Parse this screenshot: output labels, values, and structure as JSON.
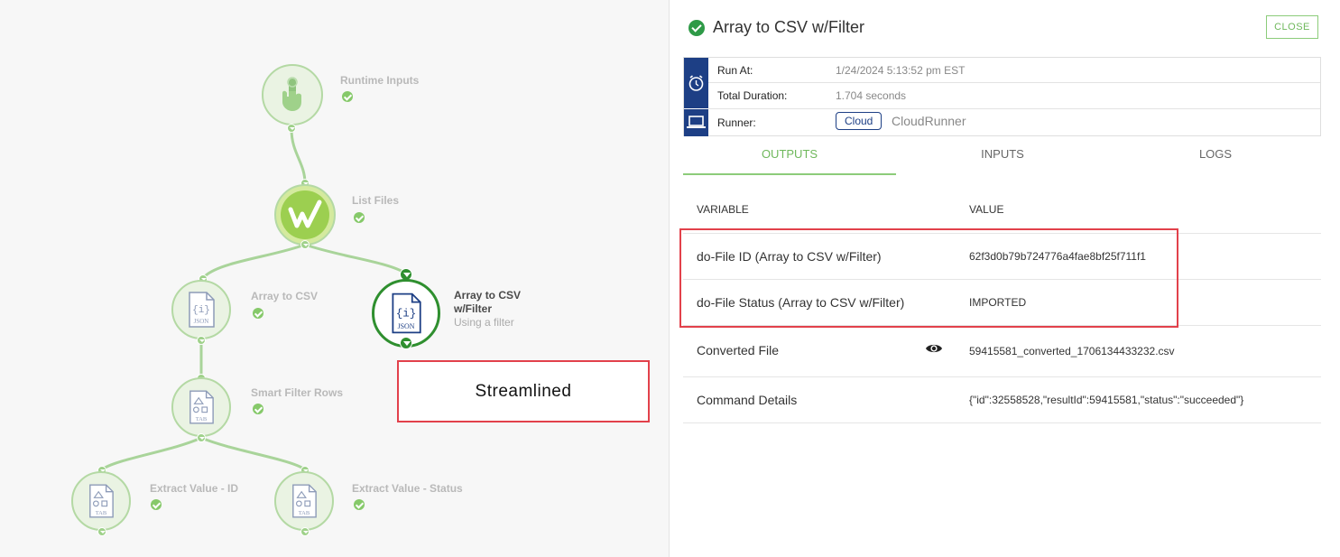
{
  "canvas": {
    "nodes": [
      {
        "id": "runtime-inputs",
        "title": "Runtime Inputs",
        "icon": "hand-pointer-icon"
      },
      {
        "id": "list-files",
        "title": "List Files",
        "icon": "w-logo-icon"
      },
      {
        "id": "array-to-csv",
        "title": "Array to CSV",
        "icon": "json-file-icon",
        "badge": "JSON"
      },
      {
        "id": "array-to-csv-filter",
        "title_line1": "Array to CSV",
        "title_line2": "w/Filter",
        "subtitle": "Using a filter",
        "icon": "json-file-icon",
        "badge": "JSON",
        "active": true
      },
      {
        "id": "smart-filter-rows",
        "title": "Smart Filter Rows",
        "icon": "tab-file-icon",
        "badge": "TAB"
      },
      {
        "id": "extract-value-id",
        "title": "Extract Value - ID",
        "icon": "tab-file-icon",
        "badge": "TAB"
      },
      {
        "id": "extract-value-status",
        "title": "Extract Value - Status",
        "icon": "tab-file-icon",
        "badge": "TAB"
      }
    ],
    "callout": "Streamlined"
  },
  "panel": {
    "title": "Array to CSV w/Filter",
    "close_label": "CLOSE",
    "meta": {
      "run_at_label": "Run At:",
      "run_at_value": "1/24/2024 5:13:52 pm EST",
      "duration_label": "Total Duration:",
      "duration_value": "1.704 seconds",
      "runner_label": "Runner:",
      "runner_tag": "Cloud",
      "runner_name": "CloudRunner"
    },
    "tabs": [
      "OUTPUTS",
      "INPUTS",
      "LOGS"
    ],
    "active_tab": "OUTPUTS",
    "table": {
      "headers": [
        "VARIABLE",
        "VALUE"
      ],
      "rows": [
        {
          "variable": "do-File ID (Array to CSV w/Filter)",
          "value": "62f3d0b79b724776a4fae8bf25f711f1"
        },
        {
          "variable": "do-File Status (Array to CSV w/Filter)",
          "value": "IMPORTED"
        },
        {
          "variable": "Converted File",
          "value": "59415581_converted_1706134433232.csv",
          "icon": "eye-icon"
        },
        {
          "variable": "Command Details",
          "value": "{\"id\":32558528,\"resultId\":59415581,\"status\":\"succeeded\"}"
        }
      ]
    }
  },
  "colors": {
    "accent_green": "#6fb85c",
    "success_green": "#2e9a47",
    "navy": "#1d3f85",
    "highlight_red": "#e2414b"
  }
}
